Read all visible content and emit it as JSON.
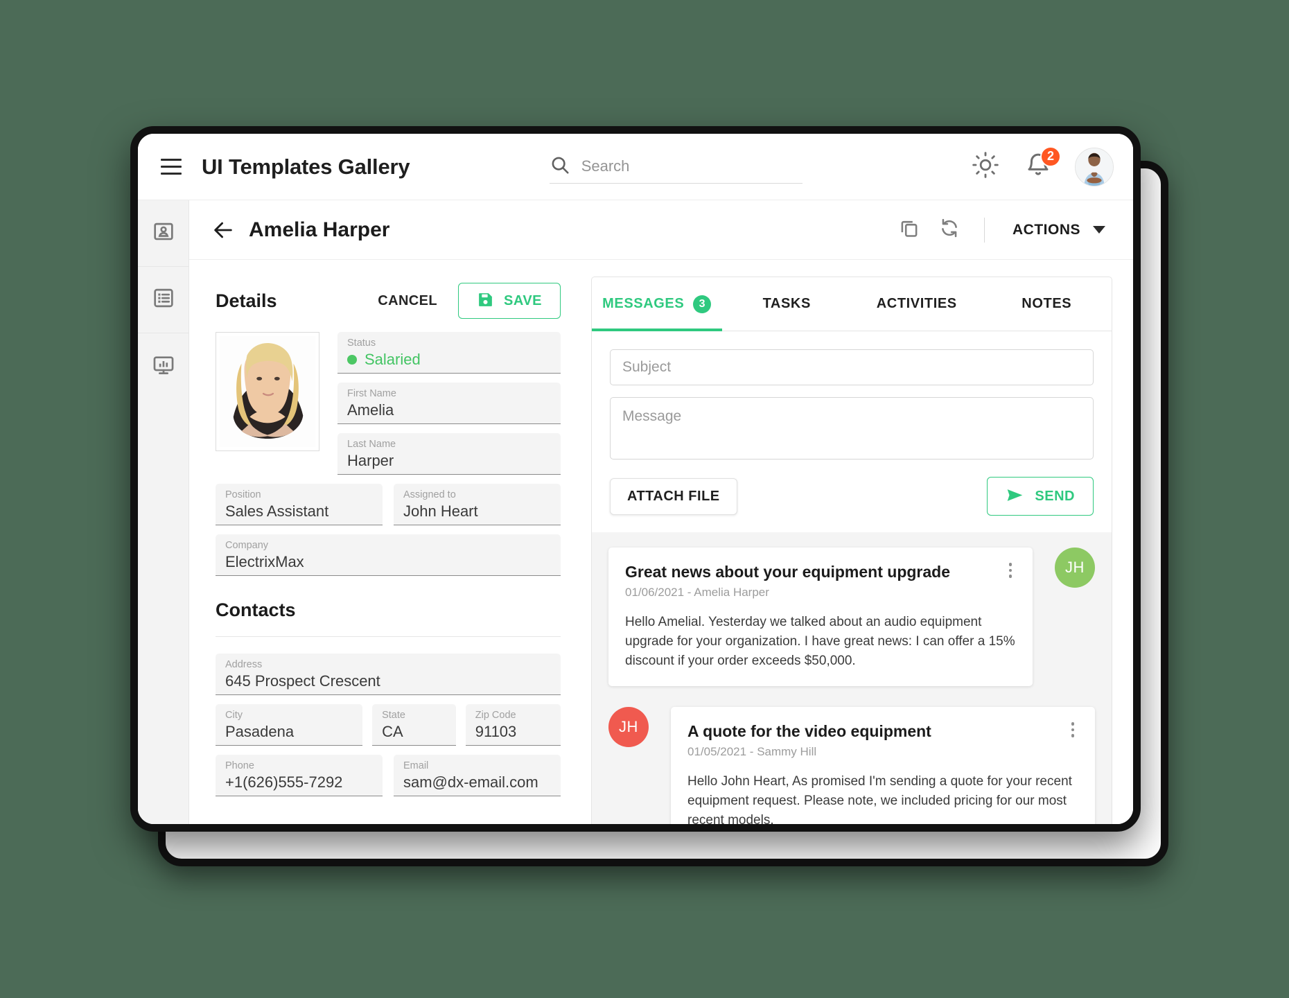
{
  "appbar": {
    "title": "UI Templates Gallery",
    "menu_icon": "hamburger-icon",
    "search": {
      "placeholder": "Search",
      "value": "",
      "icon": "search-icon"
    },
    "theme_icon": "sun-icon",
    "notifications": {
      "icon": "bell-icon",
      "badge": "2"
    },
    "avatar": "user-avatar"
  },
  "rail": {
    "items": [
      {
        "icon": "contact-card-icon",
        "name": "contacts"
      },
      {
        "icon": "list-icon",
        "name": "lists"
      },
      {
        "icon": "dashboard-monitor-icon",
        "name": "dashboard"
      }
    ]
  },
  "page": {
    "back_icon": "arrow-left-icon",
    "title": "Amelia Harper",
    "copy_icon": "copy-icon",
    "refresh_icon": "refresh-icon",
    "actions_label": "ACTIONS",
    "actions_caret": "chevron-down-icon"
  },
  "details": {
    "title": "Details",
    "cancel_label": "CANCEL",
    "save_label": "SAVE",
    "save_icon": "save-disk-icon",
    "photo_alt": "Amelia Harper photo",
    "fields": [
      {
        "label": "Status",
        "value": "Salaried",
        "type": "status",
        "dot_color": "#4cc764"
      },
      {
        "label": "First Name",
        "value": "Amelia"
      },
      {
        "label": "Last Name",
        "value": "Harper"
      },
      {
        "label": "Position",
        "value": "Sales Assistant"
      },
      {
        "label": "Assigned to",
        "value": "John Heart"
      },
      {
        "label": "Company",
        "value": "ElectrixMax"
      }
    ]
  },
  "contacts": {
    "title": "Contacts",
    "fields": [
      {
        "label": "Address",
        "value": "645 Prospect Crescent"
      },
      {
        "label": "City",
        "value": "Pasadena"
      },
      {
        "label": "State",
        "value": "CA"
      },
      {
        "label": "Zip Code",
        "value": "91103"
      },
      {
        "label": "Phone",
        "value": "+1(626)555-7292"
      },
      {
        "label": "Email",
        "value": "sam@dx-email.com"
      }
    ]
  },
  "panel": {
    "tabs": [
      {
        "label": "MESSAGES",
        "badge": "3",
        "active": true
      },
      {
        "label": "TASKS",
        "badge": "",
        "active": false
      },
      {
        "label": "ACTIVITIES",
        "badge": "",
        "active": false
      },
      {
        "label": "NOTES",
        "badge": "",
        "active": false
      }
    ],
    "compose": {
      "subject_placeholder": "Subject",
      "subject_value": "",
      "message_placeholder": "Message",
      "message_value": "",
      "attach_label": "ATTACH FILE",
      "send_label": "SEND",
      "send_icon": "send-paper-plane-icon"
    },
    "messages": [
      {
        "subject": "Great news about your equipment upgrade",
        "meta": "01/06/2021 - Amelia Harper",
        "body": "Hello Amelial. Yesterday we talked about an audio equipment upgrade for your organization. I have great news: I can offer a 15% discount if your order exceeds $50,000.",
        "initials": "JH",
        "avatar_color": "#8dc963",
        "side": "outgoing",
        "menu_icon": "more-vertical-icon"
      },
      {
        "subject": "A quote for the video equipment",
        "meta": "01/05/2021 - Sammy Hill",
        "body": "Hello John Heart, As promised I'm sending a quote for your recent equipment request. Please note, we included pricing for our most recent models.",
        "initials": "JH",
        "avatar_color": "#f05a4f",
        "side": "incoming",
        "menu_icon": "more-vertical-icon"
      }
    ]
  },
  "colors": {
    "accent_green": "#2fc97f",
    "status_green": "#4cc764",
    "badge_orange": "#ff5722",
    "avatar_green": "#8dc963",
    "avatar_red": "#f05a4f"
  }
}
